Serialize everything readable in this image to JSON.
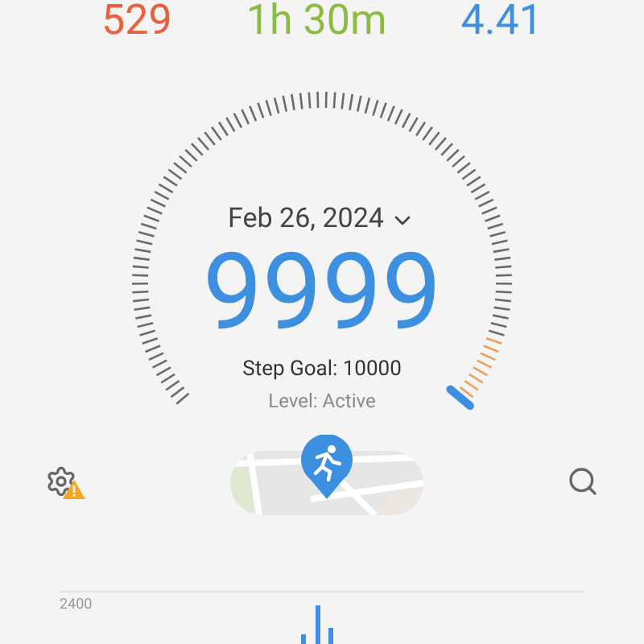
{
  "summary": [
    {
      "value": "529",
      "color": "#e8603c"
    },
    {
      "value": "1h 30m",
      "color": "#8bbb3f"
    },
    {
      "value": "4.41",
      "color": "#3d8fe0"
    }
  ],
  "date": "Feb 26, 2024",
  "steps": "9999",
  "goal": "Step Goal: 10000",
  "level_text": "Level: Active",
  "settings": {
    "warning": true
  },
  "chart": {
    "top_label": "2400"
  }
}
